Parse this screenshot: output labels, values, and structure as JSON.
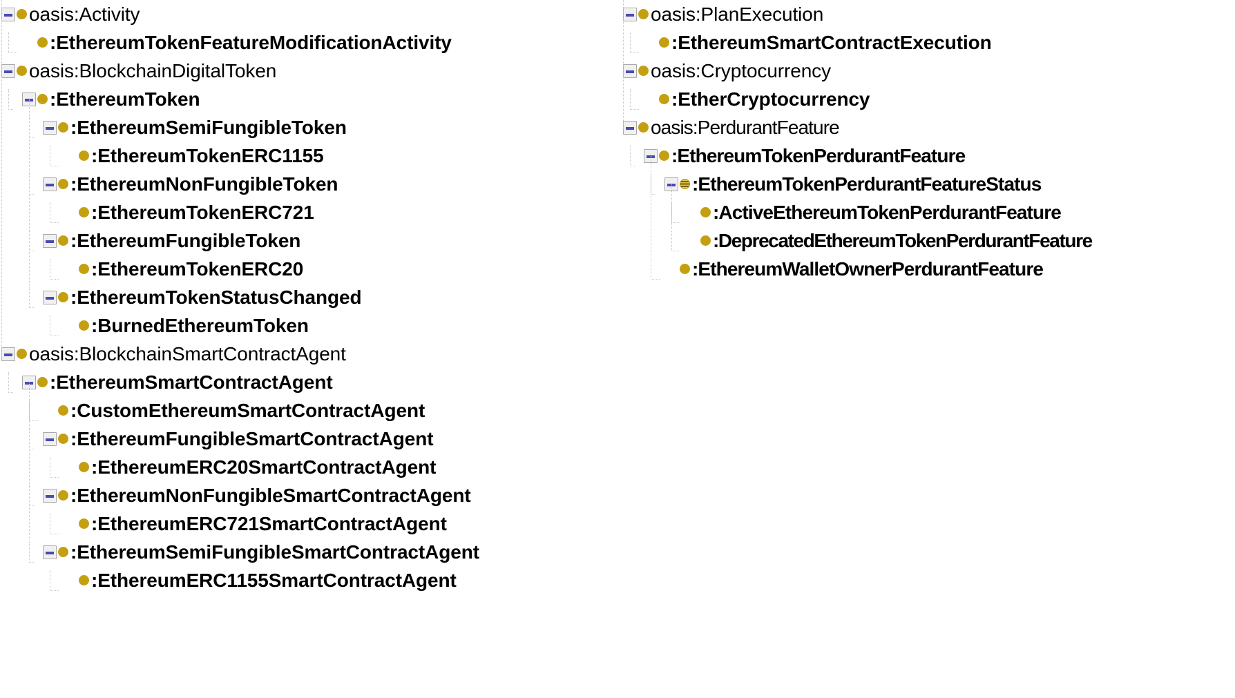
{
  "view": {
    "kind": "owl-class-hierarchy",
    "icon_color": "#c4a011",
    "defined_icon_color": "#e0c84a",
    "toggle_color": "#4a4ab0",
    "text_color": "#000000"
  },
  "columns": [
    {
      "name": "left-column",
      "rows": [
        {
          "label": "oasis:Activity",
          "depth": 0,
          "expandable": true,
          "bold": false,
          "icon": "class-icon"
        },
        {
          "label": ":EthereumTokenFeatureModificationActivity",
          "depth": 1,
          "expandable": false,
          "bold": true,
          "icon": "class-icon"
        },
        {
          "label": "oasis:BlockchainDigitalToken",
          "depth": 0,
          "expandable": true,
          "bold": false,
          "icon": "class-icon"
        },
        {
          "label": ":EthereumToken",
          "depth": 1,
          "expandable": true,
          "bold": true,
          "icon": "class-icon"
        },
        {
          "label": ":EthereumSemiFungibleToken",
          "depth": 2,
          "expandable": true,
          "bold": true,
          "icon": "class-icon"
        },
        {
          "label": ":EthereumTokenERC1155",
          "depth": 3,
          "expandable": false,
          "bold": true,
          "icon": "class-icon"
        },
        {
          "label": ":EthereumNonFungibleToken",
          "depth": 2,
          "expandable": true,
          "bold": true,
          "icon": "class-icon"
        },
        {
          "label": ":EthereumTokenERC721",
          "depth": 3,
          "expandable": false,
          "bold": true,
          "icon": "class-icon"
        },
        {
          "label": ":EthereumFungibleToken",
          "depth": 2,
          "expandable": true,
          "bold": true,
          "icon": "class-icon"
        },
        {
          "label": ":EthereumTokenERC20",
          "depth": 3,
          "expandable": false,
          "bold": true,
          "icon": "class-icon"
        },
        {
          "label": ":EthereumTokenStatusChanged",
          "depth": 2,
          "expandable": true,
          "bold": true,
          "icon": "class-icon"
        },
        {
          "label": ":BurnedEthereumToken",
          "depth": 3,
          "expandable": false,
          "bold": true,
          "icon": "class-icon"
        },
        {
          "label": "oasis:BlockchainSmartContractAgent",
          "depth": 0,
          "expandable": true,
          "bold": false,
          "icon": "class-icon"
        },
        {
          "label": ":EthereumSmartContractAgent",
          "depth": 1,
          "expandable": true,
          "bold": true,
          "icon": "class-icon"
        },
        {
          "label": ":CustomEthereumSmartContractAgent",
          "depth": 2,
          "expandable": false,
          "bold": true,
          "icon": "class-icon"
        },
        {
          "label": ":EthereumFungibleSmartContractAgent",
          "depth": 2,
          "expandable": true,
          "bold": true,
          "icon": "class-icon"
        },
        {
          "label": ":EthereumERC20SmartContractAgent",
          "depth": 3,
          "expandable": false,
          "bold": true,
          "icon": "class-icon"
        },
        {
          "label": ":EthereumNonFungibleSmartContractAgent",
          "depth": 2,
          "expandable": true,
          "bold": true,
          "icon": "class-icon"
        },
        {
          "label": ":EthereumERC721SmartContractAgent",
          "depth": 3,
          "expandable": false,
          "bold": true,
          "icon": "class-icon"
        },
        {
          "label": ":EthereumSemiFungibleSmartContractAgent",
          "depth": 2,
          "expandable": true,
          "bold": true,
          "icon": "class-icon"
        },
        {
          "label": ":EthereumERC1155SmartContractAgent",
          "depth": 3,
          "expandable": false,
          "bold": true,
          "icon": "class-icon"
        }
      ]
    },
    {
      "name": "right-column",
      "rows": [
        {
          "label": "oasis:PlanExecution",
          "depth": 0,
          "expandable": true,
          "bold": false,
          "icon": "class-icon"
        },
        {
          "label": ":EthereumSmartContractExecution",
          "depth": 1,
          "expandable": false,
          "bold": true,
          "icon": "class-icon"
        },
        {
          "label": "oasis:Cryptocurrency",
          "depth": 0,
          "expandable": true,
          "bold": false,
          "icon": "class-icon"
        },
        {
          "label": ":EtherCryptocurrency",
          "depth": 1,
          "expandable": false,
          "bold": true,
          "icon": "class-icon"
        },
        {
          "label": "oasis:PerdurantFeature",
          "depth": 0,
          "expandable": true,
          "bold": false,
          "icon": "class-icon"
        },
        {
          "label": ":EthereumTokenPerdurantFeature",
          "depth": 1,
          "expandable": true,
          "bold": true,
          "icon": "class-icon"
        },
        {
          "label": ":EthereumTokenPerdurantFeatureStatus",
          "depth": 2,
          "expandable": true,
          "bold": true,
          "icon": "defined-class-icon"
        },
        {
          "label": ":ActiveEthereumTokenPerdurantFeature",
          "depth": 3,
          "expandable": false,
          "bold": true,
          "icon": "class-icon"
        },
        {
          "label": ":DeprecatedEthereumTokenPerdurantFeature",
          "depth": 3,
          "expandable": false,
          "bold": true,
          "icon": "class-icon"
        },
        {
          "label": ":EthereumWalletOwnerPerdurantFeature",
          "depth": 2,
          "expandable": false,
          "bold": true,
          "icon": "class-icon"
        }
      ]
    }
  ]
}
